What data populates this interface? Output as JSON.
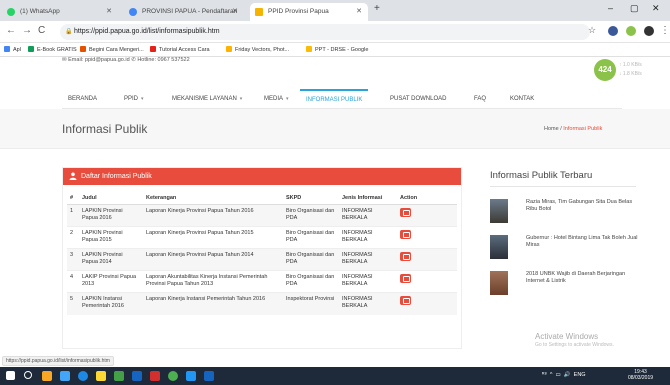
{
  "browser": {
    "tabs": [
      {
        "label": "(1) WhatsApp",
        "color": "#25d366"
      },
      {
        "label": "PROVINSI PAPUA - Pendaftaran",
        "color": "#4285f4"
      },
      {
        "label": "PPID Provinsi Papua",
        "color": "#f4b400"
      }
    ],
    "url": "https://ppid.papua.go.id/list/informasipublik.htm",
    "bookmarks": [
      "Apl",
      "E-Book GRATIS",
      "Begini Cara Mengeri...",
      "Tutorial Access Cara",
      "Friday Vectors, Phot...",
      "PPT - DRSE - Google"
    ]
  },
  "site": {
    "contact": "✉ Email: ppid@papua.go.id   ✆ Hotline: 0967 537522",
    "visitor_count": "424",
    "visitor_up": "↑ 1.0 KB/s",
    "visitor_down": "↓ 1.8 KB/s",
    "menu": [
      {
        "label": "BERANDA",
        "caret": false
      },
      {
        "label": "PPID",
        "caret": true
      },
      {
        "label": "MEKANISME LAYANAN",
        "caret": true
      },
      {
        "label": "MEDIA",
        "caret": true
      },
      {
        "label": "INFORMASI PUBLIK",
        "caret": false
      },
      {
        "label": "PUSAT DOWNLOAD",
        "caret": false
      },
      {
        "label": "FAQ",
        "caret": false
      },
      {
        "label": "KONTAK",
        "caret": false
      }
    ],
    "page_title": "Informasi Publik",
    "breadcrumb_home": "Home",
    "breadcrumb_sep": "/",
    "breadcrumb_current": "Informasi Publik"
  },
  "panel": {
    "title": "Daftar Informasi Publik",
    "columns": [
      "#",
      "Judul",
      "Keterangan",
      "SKPD",
      "Jenis Informasi",
      "Action"
    ],
    "rows": [
      {
        "no": "1",
        "judul": "LAPKIN Provinsi Papua 2016",
        "ket": "Laporan Kinerja Provinsi Papua Tahun 2016",
        "skpd": "Biro Organisasi dan PDA",
        "jenis": "INFORMASI BERKALA"
      },
      {
        "no": "2",
        "judul": "LAPKIN Provinsi Papua 2015",
        "ket": "Laporan Kinerja Provinsi Papua Tahun 2015",
        "skpd": "Biro Organisasi dan PDA",
        "jenis": "INFORMASI BERKALA"
      },
      {
        "no": "3",
        "judul": "LAPKIN Provinsi Papua 2014",
        "ket": "Laporan Kinerja Provinsi Papua Tahun 2014",
        "skpd": "Biro Organisasi dan PDA",
        "jenis": "INFORMASI BERKALA"
      },
      {
        "no": "4",
        "judul": "LAKIP Provinsi Papua 2013",
        "ket": "Laporan Akuntabilitas Kinerja Instansi Pemerintah Provinsi Papua Tahun 2013",
        "skpd": "Biro Organisasi dan PDA",
        "jenis": "INFORMASI BERKALA"
      },
      {
        "no": "5",
        "judul": "LAPKIN Instansi Pemerintah 2016",
        "ket": "Laporan Kinerja Instansi Pemerintah Tahun 2016",
        "skpd": "Inspektorat Provinsi",
        "jenis": "INFORMASI BERKALA"
      }
    ]
  },
  "sidebar": {
    "title": "Informasi Publik Terbaru",
    "news": [
      "Razia Miras, Tim Gabungan Sita Dua Belas Ribu Botol",
      "Gubernur : Hotel Bintang Lima Tak Boleh Jual Miras",
      "2018 UNBK Wajib di Daerah Berjaringan Internet & Listrik"
    ]
  },
  "watermark": {
    "title": "Activate Windows",
    "sub": "Go to Settings to activate Windows."
  },
  "status_url": "https://ppid.papua.go.id/list/informasipublik.htm",
  "taskbar": {
    "tray": "ENG",
    "time": "19:43",
    "date": "08/03/2019"
  },
  "colors": {
    "accent": "#29a3d9",
    "panel": "#e74c3c"
  }
}
